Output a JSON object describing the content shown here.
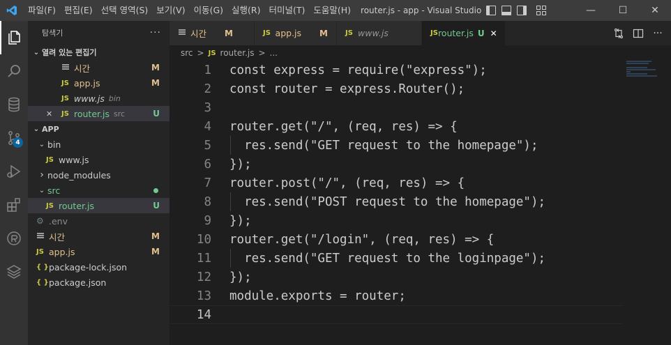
{
  "titlebar": {
    "menu": [
      "파일(F)",
      "편집(E)",
      "선택 영역(S)",
      "보기(V)",
      "이동(G)",
      "실행(R)",
      "터미널(T)",
      "도움말(H)"
    ],
    "title": "router.js - app - Visual Studio C...",
    "minimize": "—",
    "maximize": "☐",
    "close": "✕"
  },
  "activitybar": {
    "icons": [
      "explorer-icon",
      "search-icon",
      "database-icon",
      "source-control-icon",
      "run-debug-icon",
      "extensions-icon",
      "remote-icon",
      "layers-icon"
    ],
    "scm_badge": "4"
  },
  "sidebar": {
    "header": "탐색기",
    "more": "···",
    "open_editors": {
      "title": "열려 있는 편집기",
      "items": [
        {
          "name": "시간",
          "status": "M",
          "type": "text"
        },
        {
          "name": "app.js",
          "status": "M",
          "type": "js"
        },
        {
          "name": "www.js",
          "desc": "bin",
          "status": "",
          "type": "js"
        },
        {
          "name": "router.js",
          "desc": "src",
          "status": "U",
          "type": "js"
        }
      ]
    },
    "workspace": {
      "title": "APP",
      "items": [
        {
          "name": "bin",
          "kind": "folder-open"
        },
        {
          "name": "www.js",
          "kind": "js"
        },
        {
          "name": "node_modules",
          "kind": "folder"
        },
        {
          "name": "src",
          "kind": "folder-open"
        },
        {
          "name": "router.js",
          "kind": "js",
          "status": "U"
        },
        {
          "name": ".env",
          "kind": "gear"
        },
        {
          "name": "시간",
          "kind": "text",
          "status": "M"
        },
        {
          "name": "app.js",
          "kind": "js",
          "status": "M"
        },
        {
          "name": "package-lock.json",
          "kind": "json"
        },
        {
          "name": "package.json",
          "kind": "json"
        }
      ]
    }
  },
  "tabs": [
    {
      "label": "시간",
      "status": "M",
      "type": "text"
    },
    {
      "label": "app.js",
      "status": "M",
      "type": "js"
    },
    {
      "label": "www.js",
      "status": "",
      "type": "js"
    },
    {
      "label": "router.js",
      "status": "U",
      "type": "js",
      "active": true
    }
  ],
  "breadcrumb": {
    "folder": "src",
    "sep": ">",
    "file": "router.js",
    "tail": "..."
  },
  "editor": {
    "current_line": 14,
    "lines": [
      "const express = require(\"express\");",
      "const router = express.Router();",
      "",
      "router.get(\"/\", (req, res) => {",
      "  res.send(\"GET request to the homepage\");",
      "});",
      "router.post(\"/\", (req, res) => {",
      "  res.send(\"POST request to the homepage\");",
      "});",
      "router.get(\"/login\", (req, res) => {",
      "  res.send(\"GET request to the loginpage\");",
      "});",
      "module.exports = router;",
      ""
    ]
  },
  "colors": {
    "accent": "#007acc",
    "modified": "#e2c08d",
    "untracked": "#73c991",
    "js": "#cbcb41"
  }
}
